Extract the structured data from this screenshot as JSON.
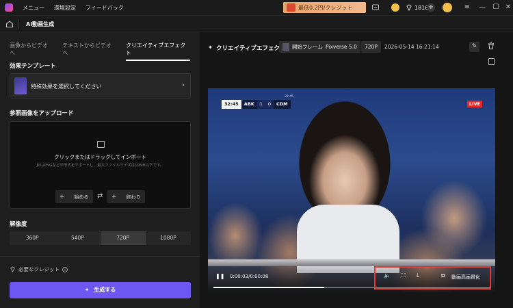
{
  "titlebar": {
    "menu": [
      "メニュー",
      "環境設定",
      "フィードバック"
    ],
    "promo_text": "最低0.2円/クレジット",
    "credits": "1816",
    "plus": "+",
    "chat_icon": "chat-bubble-icon",
    "controls": [
      "menu-icon",
      "minimize-icon",
      "maximize-icon",
      "close-icon"
    ]
  },
  "header": {
    "title": "AI動画生成"
  },
  "left": {
    "tabs": [
      {
        "label": "画像からビデオへ",
        "active": false
      },
      {
        "label": "テキストからビデオへ",
        "active": false
      },
      {
        "label": "クリエイティブエフェクト",
        "active": true
      }
    ],
    "effect_section": "効果テンプレート",
    "effect_placeholder": "特殊効果を選択してください",
    "upload_section": "参照画像をアップロード",
    "upload_title": "クリックまたはドラッグしてインポート",
    "upload_sub": "JPG/PNGなどの形式をサポートし、最大ファイルサイズは10MB以下です。",
    "start_label": "始める",
    "end_label": "終わり",
    "resolution_section": "解像度",
    "resolutions": [
      {
        "label": "360P",
        "active": false
      },
      {
        "label": "540P",
        "active": false
      },
      {
        "label": "720P",
        "active": true
      },
      {
        "label": "1080P",
        "active": false
      }
    ],
    "credit_label": "必要なクレジット",
    "generate_label": "生成する",
    "accent": "#6e56f2"
  },
  "right": {
    "title": "クリエイティブエフェクト",
    "chip_frame": "開始フレーム",
    "chip_model": "Pixverse 5.0",
    "chip_res": "720P",
    "timestamp": "2026-05-14 16:21:14",
    "video": {
      "sb_time": "32:45",
      "sb_team1": "ABK",
      "sb_score1": "1",
      "sb_score2": "0",
      "sb_team2": "CDM",
      "sb_small": "22:45",
      "live": "LIVE",
      "time": "0:00:03/0:00:08",
      "progress": 0.4,
      "enhance_label": "動画高画質化"
    }
  }
}
